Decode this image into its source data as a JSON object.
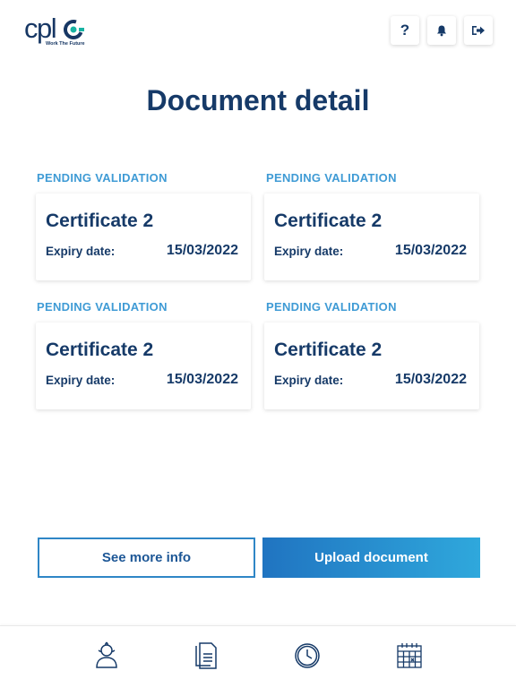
{
  "header": {
    "logo_text": "cpl",
    "logo_tagline": "Work The Future",
    "help_label": "?",
    "icons": [
      "help-icon",
      "bell-icon",
      "logout-icon"
    ]
  },
  "page_title": "Document detail",
  "documents": [
    {
      "status": "PENDING VALIDATION",
      "title": "Certificate 2",
      "expiry_label": "Expiry date:",
      "expiry_date": "15/03/2022"
    },
    {
      "status": "PENDING VALIDATION",
      "title": "Certificate 2",
      "expiry_label": "Expiry date:",
      "expiry_date": "15/03/2022"
    },
    {
      "status": "PENDING VALIDATION",
      "title": "Certificate 2",
      "expiry_label": "Expiry date:",
      "expiry_date": "15/03/2022"
    },
    {
      "status": "PENDING VALIDATION",
      "title": "Certificate 2",
      "expiry_label": "Expiry date:",
      "expiry_date": "15/03/2022"
    }
  ],
  "actions": {
    "see_more_label": "See more info",
    "upload_label": "Upload document"
  },
  "bottom_nav": [
    "profile-icon",
    "documents-icon",
    "clock-icon",
    "calendar-icon"
  ],
  "colors": {
    "primary": "#163a68",
    "accent": "#3f9bd5",
    "button_gradient_start": "#2074c1",
    "button_gradient_end": "#2fa8dc",
    "logo_green": "#17b3a3"
  }
}
